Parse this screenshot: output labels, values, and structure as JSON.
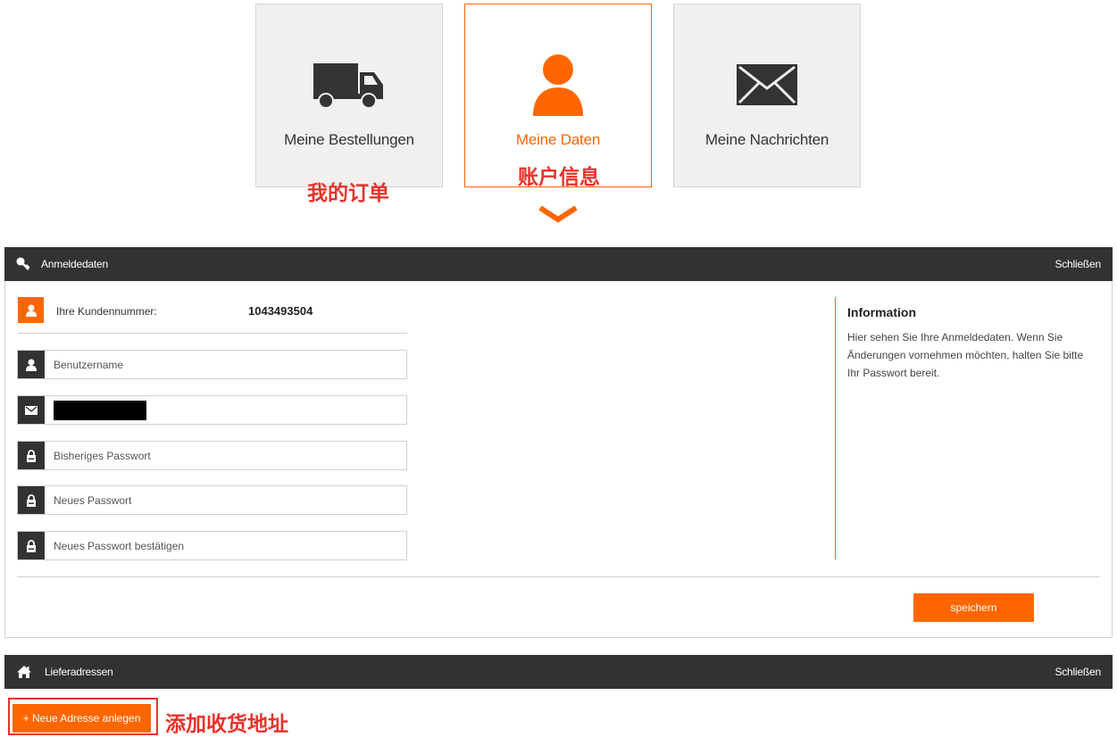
{
  "tiles": [
    {
      "label": "Meine Bestellungen",
      "icon": "truck-icon",
      "annotation": "我的订单"
    },
    {
      "label": "Meine Daten",
      "icon": "user-icon",
      "annotation": "账户信息",
      "active": true
    },
    {
      "label": "Meine Nachrichten",
      "icon": "envelope-icon"
    }
  ],
  "login_panel": {
    "title": "Anmeldedaten",
    "close_label": "Schließen",
    "customer_number_label": "Ihre Kundennummer:",
    "customer_number": "1043493504",
    "fields": {
      "username_placeholder": "Benutzername",
      "email_value": "",
      "old_password_placeholder": "Bisheriges Passwort",
      "new_password_placeholder": "Neues Passwort",
      "confirm_password_placeholder": "Neues Passwort bestätigen"
    },
    "info_title": "Information",
    "info_text": "Hier sehen Sie Ihre Anmeldedaten. Wenn Sie Änderungen vornehmen möchten, halten Sie bitte Ihr Passwort bereit.",
    "save_label": "speichern"
  },
  "address_panel": {
    "title": "Lieferadressen",
    "close_label": "Schließen",
    "new_address_label": "+ Neue Adresse anlegen",
    "annotation": "添加收货地址"
  },
  "colors": {
    "accent": "#ff6600",
    "dark": "#323232",
    "annotation": "#e8332b",
    "tile_bg": "#f1f0ee"
  }
}
